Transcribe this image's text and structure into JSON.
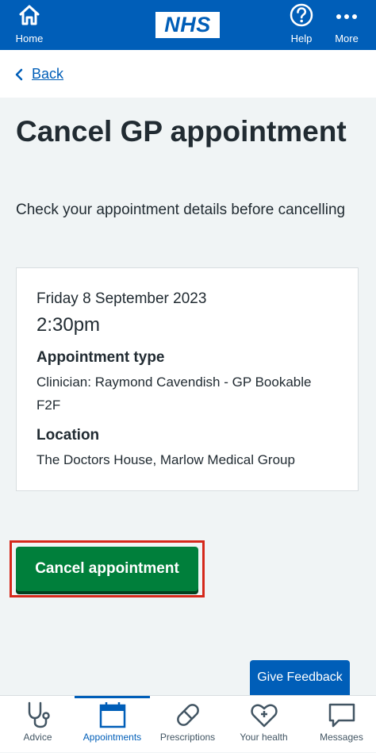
{
  "header": {
    "home_label": "Home",
    "logo_text": "NHS",
    "help_label": "Help",
    "more_label": "More",
    "icons": {
      "home": "home-icon",
      "help": "help-icon",
      "more": "more-icon"
    }
  },
  "back": {
    "label": "Back"
  },
  "page": {
    "title": "Cancel GP appointment",
    "subtitle": "Check your appointment details before cancelling"
  },
  "appointment": {
    "date": "Friday 8 September 2023",
    "time": "2:30pm",
    "type_heading": "Appointment type",
    "type_value": "Clinician: Raymond Cavendish - GP Bookable F2F",
    "location_heading": "Location",
    "location_value": "The Doctors House, Marlow Medical Group"
  },
  "actions": {
    "cancel_label": "Cancel appointment",
    "feedback_label": "Give Feedback"
  },
  "bottom_nav": {
    "items": [
      {
        "label": "Advice",
        "icon": "stethoscope-icon",
        "active": false
      },
      {
        "label": "Appointments",
        "icon": "calendar-icon",
        "active": true
      },
      {
        "label": "Prescriptions",
        "icon": "pill-icon",
        "active": false
      },
      {
        "label": "Your health",
        "icon": "heart-plus-icon",
        "active": false
      },
      {
        "label": "Messages",
        "icon": "message-icon",
        "active": false
      }
    ]
  },
  "colors": {
    "brand_blue": "#005eb8",
    "action_green": "#007f3b",
    "highlight_red": "#d5281b",
    "page_background": "#f0f4f5"
  }
}
